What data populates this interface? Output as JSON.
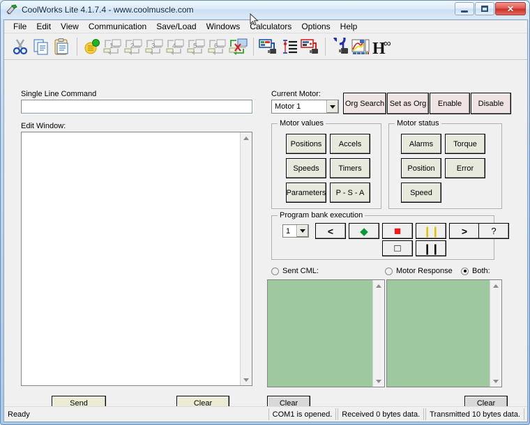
{
  "window": {
    "title": "CoolWorks Lite 4.1.7.4 - www.coolmuscle.com",
    "minimize_label": "Minimize",
    "maximize_label": "Maximize",
    "close_label": "✕"
  },
  "menubar": {
    "items": [
      {
        "label": "File"
      },
      {
        "label": "Edit"
      },
      {
        "label": "View"
      },
      {
        "label": "Communication"
      },
      {
        "label": "Save/Load"
      },
      {
        "label": "Windows"
      },
      {
        "label": "Calculators"
      },
      {
        "label": "Options"
      },
      {
        "label": "Help"
      }
    ]
  },
  "toolbar": {
    "items": [
      {
        "name": "cut-icon",
        "label": "Cut"
      },
      {
        "name": "copy-icon",
        "label": "Copy"
      },
      {
        "name": "paste-icon",
        "label": "Paste"
      },
      {
        "name": "bank-all-icon",
        "label": "All banks"
      },
      {
        "name": "bank-1-icon",
        "label": "Bank 1"
      },
      {
        "name": "bank-2-icon",
        "label": "Bank 2"
      },
      {
        "name": "bank-3-icon",
        "label": "Bank 3"
      },
      {
        "name": "bank-4-icon",
        "label": "Bank 4"
      },
      {
        "name": "bank-5-icon",
        "label": "Bank 5"
      },
      {
        "name": "bank-6-icon",
        "label": "Bank 6"
      },
      {
        "name": "bank-clear-icon",
        "label": "Clear bank"
      },
      {
        "name": "motor-parameters-icon",
        "label": "Motor parameters"
      },
      {
        "name": "position-list-icon",
        "label": "Position list"
      },
      {
        "name": "motor-status-icon",
        "label": "Motor status"
      },
      {
        "name": "motor-reset-icon",
        "label": "Motor reset"
      },
      {
        "name": "graph-icon",
        "label": "Graph monitor"
      },
      {
        "name": "h-infinity-icon",
        "label": "H infinity"
      }
    ]
  },
  "left_panel": {
    "single_line_command_label": "Single Line Command",
    "single_line_command_value": "",
    "single_line_command_placeholder": "",
    "edit_window_label": "Edit Window:",
    "edit_window_value": "",
    "send_button": "Send",
    "clear_button": "Clear"
  },
  "motor": {
    "current_motor_label": "Current Motor:",
    "current_motor_value": "Motor 1",
    "current_motor_options": [
      "Motor 1"
    ],
    "actions": [
      {
        "label": "Org Search",
        "name": "org-search-button"
      },
      {
        "label": "Set as Org",
        "name": "set-as-org-button"
      },
      {
        "label": "Enable",
        "name": "enable-button"
      },
      {
        "label": "Disable",
        "name": "disable-button"
      }
    ]
  },
  "motor_values": {
    "title": "Motor values",
    "buttons": [
      {
        "label": "Positions",
        "name": "positions-button"
      },
      {
        "label": "Accels",
        "name": "accels-button"
      },
      {
        "label": "Speeds",
        "name": "speeds-button"
      },
      {
        "label": "Timers",
        "name": "timers-button"
      },
      {
        "label": "Parameters",
        "name": "parameters-button"
      },
      {
        "label": "P - S - A",
        "name": "psa-button"
      }
    ]
  },
  "motor_status": {
    "title": "Motor status",
    "buttons": [
      {
        "label": "Alarms",
        "name": "alarms-button"
      },
      {
        "label": "Torque",
        "name": "torque-button"
      },
      {
        "label": "Position",
        "name": "position-button"
      },
      {
        "label": "Error",
        "name": "error-button"
      },
      {
        "label": "Speed",
        "name": "speed-button"
      }
    ]
  },
  "program_bank": {
    "title": "Program bank execution",
    "bank_value": "1",
    "bank_options": [
      "1"
    ],
    "controls": [
      {
        "name": "step-back-button",
        "glyph": "<"
      },
      {
        "name": "run-button",
        "glyph": "◆"
      },
      {
        "name": "stop-button",
        "glyph": "■"
      },
      {
        "name": "pause-button",
        "glyph": "❙❙"
      },
      {
        "name": "step-forward-button",
        "glyph": ">"
      },
      {
        "name": "help-button",
        "glyph": "?"
      },
      {
        "name": "stop-outline-button",
        "glyph": "□"
      },
      {
        "name": "pause-black-button",
        "glyph": "❙❙"
      }
    ]
  },
  "console": {
    "sent_cml_label": "Sent CML:",
    "motor_response_label": "Motor Response",
    "both_label": "Both:",
    "selected": "Both:",
    "sent_text": "",
    "response_text": "",
    "clear_left_button": "Clear",
    "clear_right_button": "Clear"
  },
  "statusbar": {
    "ready": "Ready",
    "com": "COM1 is opened.",
    "received": "Received 0 bytes data.",
    "transmitted": "Transmitted 10 bytes data."
  },
  "colors": {
    "console_green": "#9ec99e",
    "action_button": "#f0e3e3",
    "value_button": "#e6e9dc",
    "cream_button": "#ecebd3",
    "run_green": "#009b33",
    "stop_red": "#ee1c1c",
    "pause_yellow": "#e0c000"
  }
}
